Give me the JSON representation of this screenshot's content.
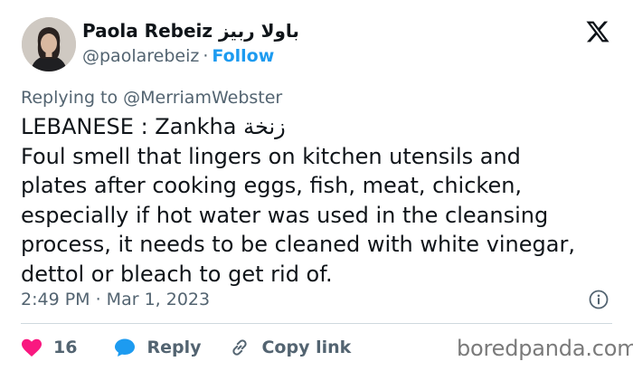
{
  "author": {
    "display_name": "Paola Rebeiz باولا ربيز",
    "handle": "@paolarebeiz",
    "separator": "·",
    "follow_label": "Follow"
  },
  "reply_context": {
    "text": "Replying to @MerriamWebster"
  },
  "tweet": {
    "text": "LEBANESE : Zankha زنخة\nFoul smell that lingers on kitchen utensils and\nplates after cooking eggs, fish, meat, chicken,\nespecially if hot water was used in the cleansing\nprocess, it needs to be cleaned with white vinegar,\ndettol or bleach to get rid of.",
    "timestamp": "2:49 PM · Mar 1, 2023"
  },
  "actions": {
    "like_count": "16",
    "reply_label": "Reply",
    "copy_link_label": "Copy link"
  },
  "watermark": {
    "text": "boredpanda.com"
  },
  "icons": {
    "platform_logo": "x-logo-icon",
    "info": "info-icon",
    "like": "heart-icon",
    "reply": "speech-bubble-icon",
    "copy_link": "link-icon"
  },
  "colors": {
    "text_primary": "#0f1419",
    "text_secondary": "#536471",
    "accent_blue": "#1d9bf0",
    "heart_pink": "#f91880",
    "divider": "#cfd9de",
    "watermark": "#7a7a7a"
  }
}
